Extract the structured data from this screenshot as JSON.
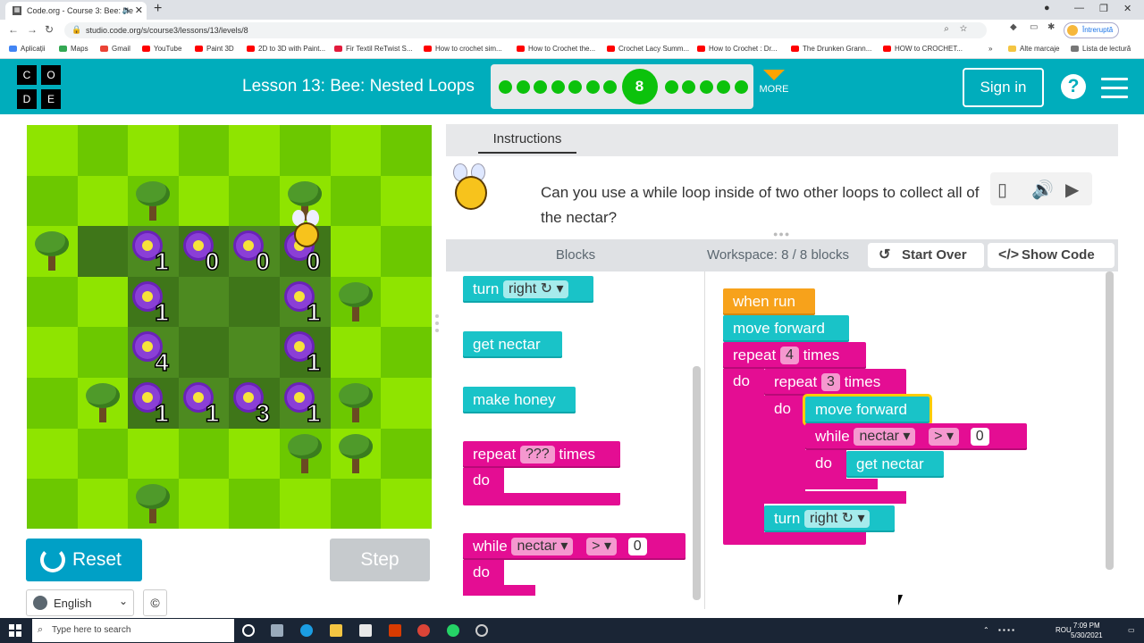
{
  "browser": {
    "tab_title": "Code.org - Course 3: Bee: Ne",
    "favicon": "code-grid-icon",
    "url": "studio.code.org/s/course3/lessons/13/levels/8",
    "profile_label": "Întreruptă",
    "bookmarks": [
      {
        "label": "Aplicații",
        "color": "#4285f4"
      },
      {
        "label": "Maps",
        "color": "#34a853"
      },
      {
        "label": "Gmail",
        "color": "#ea4335"
      },
      {
        "label": "YouTube",
        "color": "#ff0000"
      },
      {
        "label": "Paint 3D",
        "color": "#ff0000"
      },
      {
        "label": "2D to 3D with Paint...",
        "color": "#ff0000"
      },
      {
        "label": "Fir Textil ReTwist S...",
        "color": "#e21b3c"
      },
      {
        "label": "How to crochet sim...",
        "color": "#ff0000"
      },
      {
        "label": "How to Crochet the...",
        "color": "#ff0000"
      },
      {
        "label": "Crochet Lacy Summ...",
        "color": "#ff0000"
      },
      {
        "label": "How to Crochet : Dr...",
        "color": "#ff0000"
      },
      {
        "label": "The Drunken Grann...",
        "color": "#ff0000"
      },
      {
        "label": "HOW to CROCHET...",
        "color": "#ff0000"
      }
    ],
    "other_bookmarks": "Alte marcaje",
    "reading_list": "Lista de lectură"
  },
  "header": {
    "logo_letters": [
      "C",
      "O",
      "D",
      "E"
    ],
    "lesson_title": "Lesson 13: Bee: Nested Loops",
    "current_level": "8",
    "levels_before": 7,
    "levels_after": 5,
    "more_label": "MORE",
    "signin_label": "Sign in",
    "help_label": "?"
  },
  "game": {
    "flowers": [
      {
        "row": 2,
        "col": 2,
        "nectar": "1"
      },
      {
        "row": 2,
        "col": 3,
        "nectar": "0"
      },
      {
        "row": 2,
        "col": 4,
        "nectar": "0"
      },
      {
        "row": 2,
        "col": 5,
        "nectar": "0"
      },
      {
        "row": 3,
        "col": 2,
        "nectar": "1"
      },
      {
        "row": 3,
        "col": 5,
        "nectar": "1"
      },
      {
        "row": 4,
        "col": 2,
        "nectar": "4"
      },
      {
        "row": 4,
        "col": 5,
        "nectar": "1"
      },
      {
        "row": 5,
        "col": 2,
        "nectar": "1"
      },
      {
        "row": 5,
        "col": 3,
        "nectar": "1"
      },
      {
        "row": 5,
        "col": 4,
        "nectar": "3"
      },
      {
        "row": 5,
        "col": 5,
        "nectar": "1"
      }
    ],
    "trees": [
      {
        "row": 1,
        "col": 2
      },
      {
        "row": 1,
        "col": 5
      },
      {
        "row": 2,
        "col": 0
      },
      {
        "row": 3,
        "col": 6
      },
      {
        "row": 5,
        "col": 1
      },
      {
        "row": 5,
        "col": 6
      },
      {
        "row": 6,
        "col": 5
      },
      {
        "row": 6,
        "col": 6
      },
      {
        "row": 7,
        "col": 2
      }
    ],
    "path_cells": [
      [
        2,
        1
      ],
      [
        2,
        2
      ],
      [
        2,
        3
      ],
      [
        2,
        4
      ],
      [
        2,
        5
      ],
      [
        3,
        2
      ],
      [
        3,
        3
      ],
      [
        3,
        4
      ],
      [
        3,
        5
      ],
      [
        4,
        2
      ],
      [
        4,
        3
      ],
      [
        4,
        4
      ],
      [
        4,
        5
      ],
      [
        5,
        2
      ],
      [
        5,
        3
      ],
      [
        5,
        4
      ],
      [
        5,
        5
      ]
    ],
    "bee": {
      "row": 2,
      "col": 5
    },
    "colors": {
      "grass_light": "#8fe400",
      "grass_dark": "#6cc800",
      "path": "#4d8a20",
      "path_dark": "#3f7619"
    }
  },
  "controls": {
    "reset_label": "Reset",
    "step_label": "Step",
    "language": "English",
    "copyright_symbol": "©"
  },
  "instructions": {
    "tab_label": "Instructions",
    "text": "Can you use a while loop inside of two other loops to collect all of the nectar?",
    "icons": [
      "text-to-speech-icon",
      "volume-icon",
      "play-icon"
    ]
  },
  "blocks_header": {
    "blocks_label": "Blocks",
    "workspace_label": "Workspace: 8 / 8 blocks",
    "start_over_label": "Start Over",
    "show_code_label": "Show Code"
  },
  "toolbox": {
    "turn": {
      "label": "turn",
      "dir": "right ↻ ▾"
    },
    "get_nectar": "get nectar",
    "make_honey": "make honey",
    "repeat": {
      "label": "repeat",
      "count": "???",
      "suffix": "times",
      "do": "do"
    },
    "while": {
      "label": "while",
      "var": "nectar ▾",
      "op": "> ▾",
      "value": "0",
      "do": "do"
    }
  },
  "workspace": {
    "when_run": "when run",
    "move_forward_1": "move forward",
    "repeat_outer": {
      "label": "repeat",
      "count": "4",
      "suffix": "times",
      "do": "do"
    },
    "repeat_inner": {
      "label": "repeat",
      "count": "3",
      "suffix": "times",
      "do": "do"
    },
    "move_forward_2": "move forward",
    "while": {
      "label": "while",
      "var": "nectar ▾",
      "op": "> ▾",
      "value": "0",
      "do": "do"
    },
    "get_nectar": "get nectar",
    "turn": {
      "label": "turn",
      "dir": "right ↻ ▾"
    }
  },
  "taskbar": {
    "search_placeholder": "Type here to search",
    "lang": "ROU",
    "time": "7:09 PM",
    "date": "5/30/2021"
  }
}
